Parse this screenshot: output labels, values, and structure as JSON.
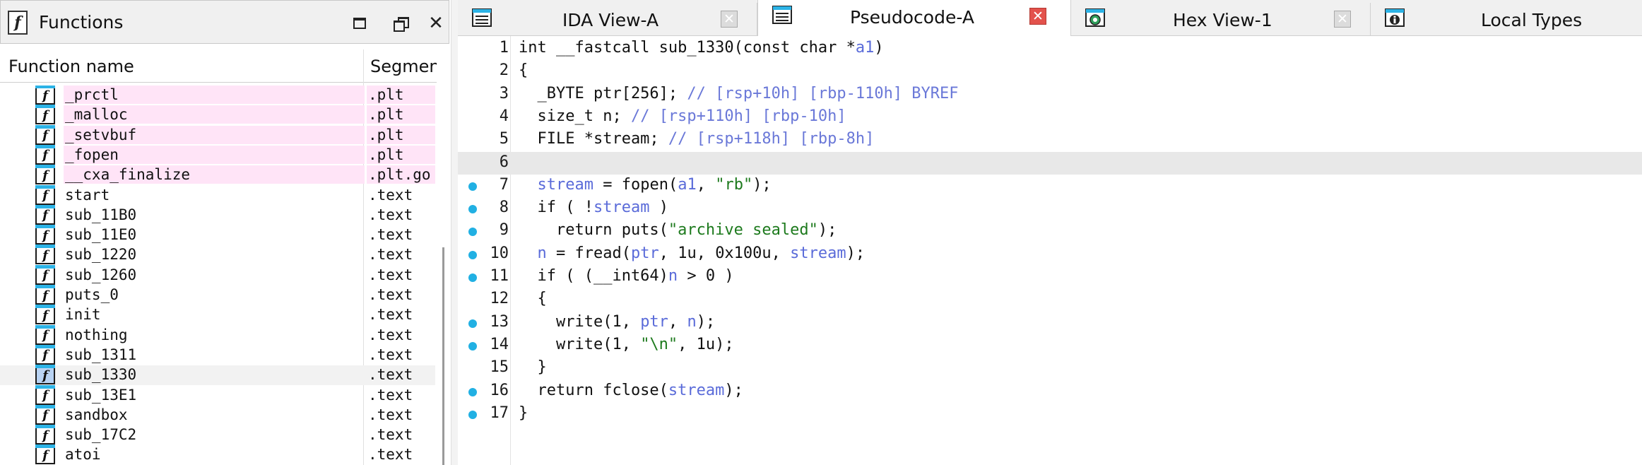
{
  "functions_pane": {
    "title": "Functions",
    "columns": {
      "name": "Function name",
      "segment": "Segmen"
    },
    "rows": [
      {
        "name": "_prctl",
        "segment": ".plt",
        "highlight": true
      },
      {
        "name": "_malloc",
        "segment": ".plt",
        "highlight": true
      },
      {
        "name": "_setvbuf",
        "segment": ".plt",
        "highlight": true
      },
      {
        "name": "_fopen",
        "segment": ".plt",
        "highlight": true
      },
      {
        "name": "__cxa_finalize",
        "segment": ".plt.go",
        "highlight": true
      },
      {
        "name": "start",
        "segment": ".text",
        "highlight": false
      },
      {
        "name": "sub_11B0",
        "segment": ".text",
        "highlight": false
      },
      {
        "name": "sub_11E0",
        "segment": ".text",
        "highlight": false
      },
      {
        "name": "sub_1220",
        "segment": ".text",
        "highlight": false
      },
      {
        "name": "sub_1260",
        "segment": ".text",
        "highlight": false
      },
      {
        "name": "puts_0",
        "segment": ".text",
        "highlight": false
      },
      {
        "name": "init",
        "segment": ".text",
        "highlight": false
      },
      {
        "name": "nothing",
        "segment": ".text",
        "highlight": false
      },
      {
        "name": "sub_1311",
        "segment": ".text",
        "highlight": false
      },
      {
        "name": "sub_1330",
        "segment": ".text",
        "highlight": false,
        "selected": true
      },
      {
        "name": "sub_13E1",
        "segment": ".text",
        "highlight": false
      },
      {
        "name": "sandbox",
        "segment": ".text",
        "highlight": false
      },
      {
        "name": "sub_17C2",
        "segment": ".text",
        "highlight": false
      },
      {
        "name": "atoi",
        "segment": ".text",
        "highlight": false
      }
    ]
  },
  "tabs": [
    {
      "label": "IDA View-A",
      "icon": "ida-view-icon",
      "active": false
    },
    {
      "label": "Pseudocode-A",
      "icon": "pseudocode-icon",
      "active": true
    },
    {
      "label": "Hex View-1",
      "icon": "hex-view-icon",
      "active": false
    },
    {
      "label": "Local Types",
      "icon": "local-types-icon",
      "active": false
    }
  ],
  "pseudocode": {
    "lines": [
      {
        "num": "1",
        "bp": false,
        "html": "int __fastcall sub_1330(const char *<span class='t-var'>a1</span>)"
      },
      {
        "num": "2",
        "bp": false,
        "html": "{"
      },
      {
        "num": "3",
        "bp": false,
        "html": "  _BYTE ptr[256]; <span class='t-cmt'>// [rsp+10h] [rbp-110h] BYREF</span>"
      },
      {
        "num": "4",
        "bp": false,
        "html": "  size_t n; <span class='t-cmt'>// [rsp+110h] [rbp-10h]</span>"
      },
      {
        "num": "5",
        "bp": false,
        "html": "  FILE *stream; <span class='t-cmt'>// [rsp+118h] [rbp-8h]</span>"
      },
      {
        "num": "6",
        "bp": false,
        "current": true,
        "html": ""
      },
      {
        "num": "7",
        "bp": true,
        "html": "  <span class='t-var'>stream</span> = fopen(<span class='t-var'>a1</span>, <span class='t-str'>\"rb\"</span>);"
      },
      {
        "num": "8",
        "bp": true,
        "html": "  if ( !<span class='t-var'>stream</span> )"
      },
      {
        "num": "9",
        "bp": true,
        "html": "    return puts(<span class='t-str'>\"archive sealed\"</span>);"
      },
      {
        "num": "10",
        "bp": true,
        "html": "  <span class='t-var'>n</span> = fread(<span class='t-var'>ptr</span>, 1u, 0x100u, <span class='t-var'>stream</span>);"
      },
      {
        "num": "11",
        "bp": true,
        "html": "  if ( (__int64)<span class='t-var'>n</span> &gt; 0 )"
      },
      {
        "num": "12",
        "bp": false,
        "html": "  {"
      },
      {
        "num": "13",
        "bp": true,
        "html": "    write(1, <span class='t-var'>ptr</span>, <span class='t-var'>n</span>);"
      },
      {
        "num": "14",
        "bp": true,
        "html": "    write(1, <span class='t-str'>\"\\n\"</span>, 1u);"
      },
      {
        "num": "15",
        "bp": false,
        "html": "  }"
      },
      {
        "num": "16",
        "bp": true,
        "html": "  return fclose(<span class='t-var'>stream</span>);"
      },
      {
        "num": "17",
        "bp": true,
        "html": "}"
      }
    ]
  }
}
